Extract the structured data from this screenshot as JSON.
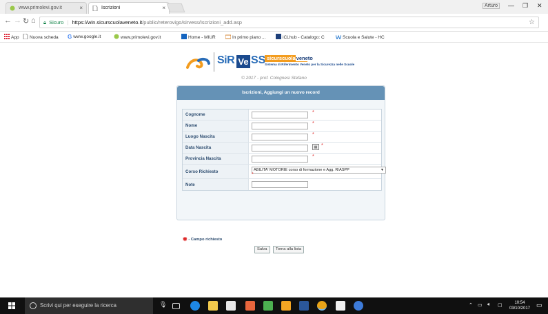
{
  "browser": {
    "tabs": [
      {
        "title": "www.primolevi.gov.it",
        "active": false
      },
      {
        "title": "Iscrizioni",
        "active": true
      }
    ],
    "user": "Arturo",
    "window_controls": {
      "minimize": "—",
      "maximize": "❐",
      "close": "✕"
    },
    "address": {
      "secure_label": "Sicuro",
      "host": "https://win.sicurscuolaveneto.it",
      "path": "/public/reterovigo/sirvess/Iscrizioni_add.asp"
    },
    "bookmarks": [
      "App",
      "Nuova scheda",
      "www.google.it",
      "www.primolevi.gov.it",
      "Home - MIUR",
      "In primo piano ...",
      "iCLhub - Catalogo: C",
      "Scuola e Salute - HC"
    ]
  },
  "logo": {
    "sir": "SiR",
    "ve": "Ve",
    "ss": "SS",
    "brand_prefix": "sicurscuola",
    "brand_highlight": "veneto",
    "brand_suffix": ".it",
    "subtitle": "Sistema di Riferimento Veneto per la Sicurezza nelle Scuole",
    "copyright": "© 2017 - prof. Colognesi Stefano"
  },
  "form": {
    "header": "Iscrizioni, Aggiungi un nuovo record",
    "fields": [
      {
        "label": "Cognome",
        "value": "",
        "required": "*"
      },
      {
        "label": "Nome",
        "value": "",
        "required": "*"
      },
      {
        "label": "Luogo Nascita",
        "value": "",
        "required": "*"
      },
      {
        "label": "Data Nascita",
        "value": "",
        "required": "*"
      },
      {
        "label": "Provincia Nascita",
        "value": "",
        "required": "*"
      },
      {
        "label": "Corso Richiesto",
        "value": "ABILITA' MOTORIE corso di formazione e Agg. R/ASPP",
        "required": "*"
      },
      {
        "label": "Note",
        "value": ""
      }
    ],
    "required_note": "- Campo richiesto",
    "buttons": {
      "save": "Salva",
      "back": "Torna alla lista"
    }
  },
  "taskbar": {
    "search_placeholder": "Scrivi qui per eseguire la ricerca",
    "time": "10:54",
    "date": "03/10/2017"
  }
}
